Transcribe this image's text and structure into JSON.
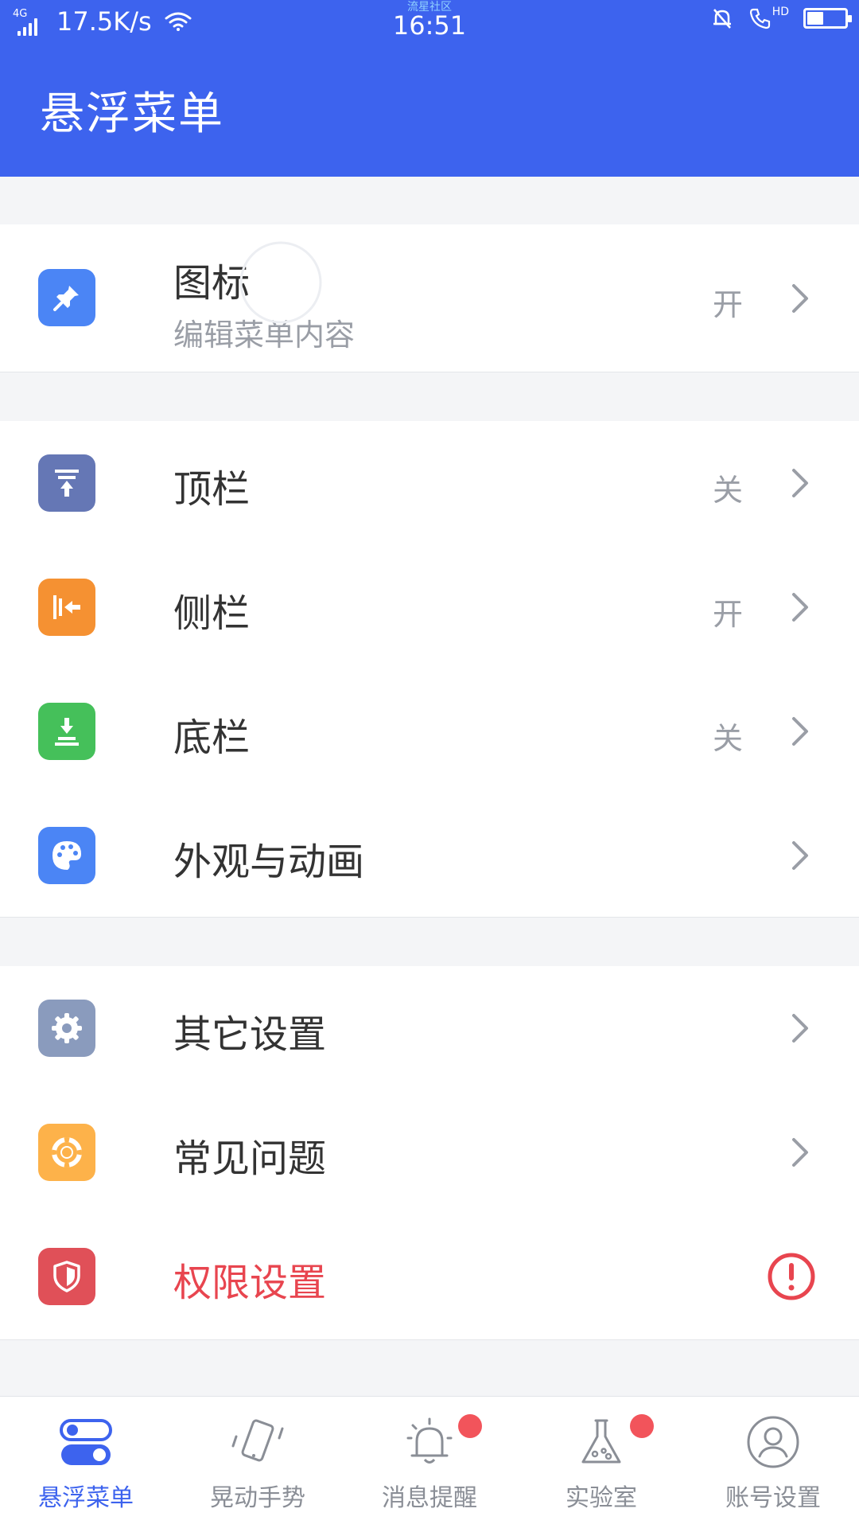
{
  "status_bar": {
    "network": "4G",
    "speed": "17.5K/s",
    "small_text": "流星社区",
    "time": "16:51",
    "hd": "HD"
  },
  "app_bar": {
    "title": "悬浮菜单"
  },
  "section1": {
    "icon": {
      "title": "图标",
      "subtitle": "编辑菜单内容",
      "value": "开"
    }
  },
  "section2": {
    "top_bar": {
      "title": "顶栏",
      "value": "关"
    },
    "side_bar": {
      "title": "侧栏",
      "value": "开"
    },
    "bottom_bar": {
      "title": "底栏",
      "value": "关"
    },
    "appearance": {
      "title": "外观与动画"
    }
  },
  "section3": {
    "other": {
      "title": "其它设置"
    },
    "faq": {
      "title": "常见问题"
    },
    "permission": {
      "title": "权限设置"
    }
  },
  "bottom_nav": {
    "items": [
      {
        "label": "悬浮菜单"
      },
      {
        "label": "晃动手势"
      },
      {
        "label": "消息提醒"
      },
      {
        "label": "实验室"
      },
      {
        "label": "账号设置"
      }
    ]
  },
  "colors": {
    "primary": "#3d63ee",
    "warning": "#e8454f",
    "pin_icon": "#4b85f5",
    "top_bar_icon": "#6577b5",
    "side_bar_icon": "#f59132",
    "bottom_bar_icon": "#45c05a",
    "palette_icon": "#4b85f5",
    "settings_icon": "#8a9bbd",
    "faq_icon": "#fdb24a",
    "shield_icon": "#e05058"
  }
}
